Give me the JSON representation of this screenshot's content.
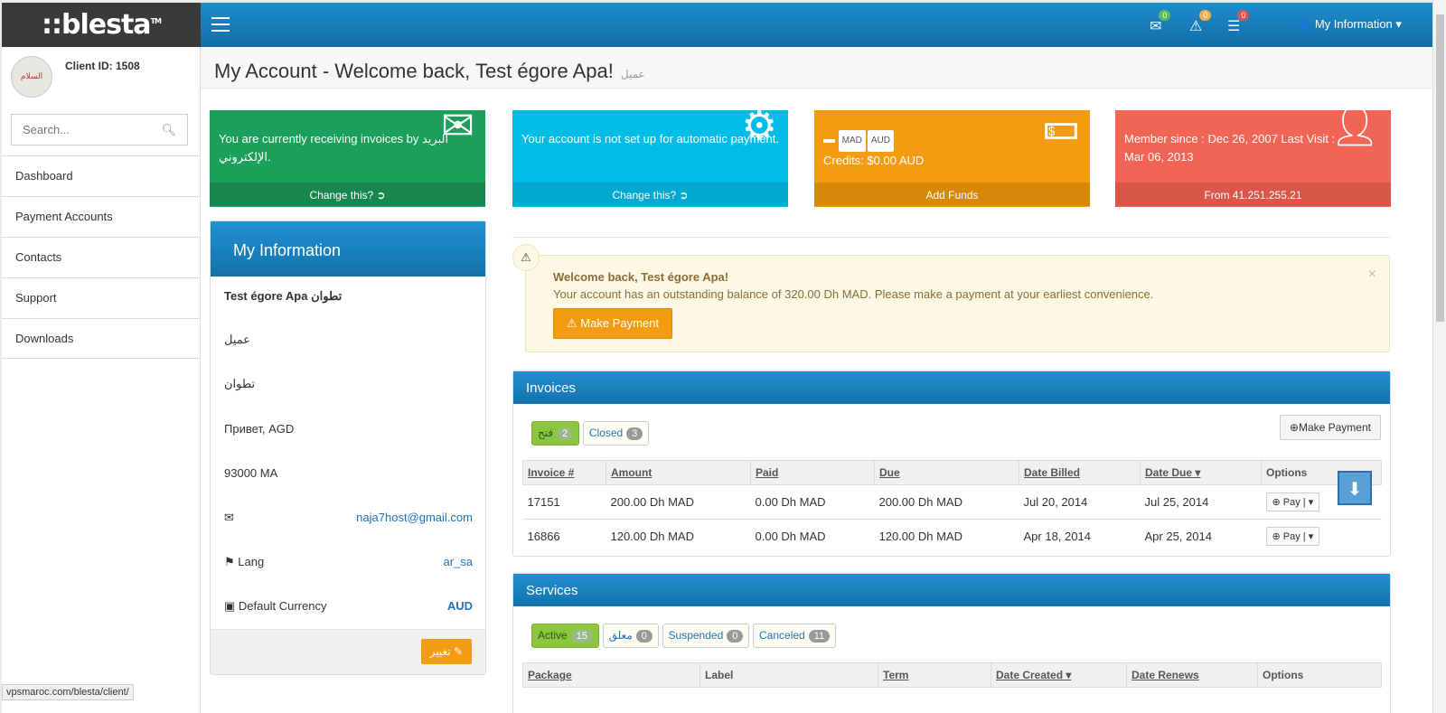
{
  "brand": {
    "logo_text": "::blesta",
    "tm": "TM"
  },
  "topbar": {
    "messages_count": "0",
    "alerts_count": "0",
    "tasks_count": "0",
    "user_menu": "My Information"
  },
  "sidebar": {
    "client_id": "Client ID: 1508",
    "avatar_text": "السلام",
    "search_placeholder": "Search...",
    "items": [
      {
        "label": "Dashboard"
      },
      {
        "label": "Payment Accounts"
      },
      {
        "label": "Contacts"
      },
      {
        "label": "Support"
      },
      {
        "label": "Downloads"
      }
    ]
  },
  "page": {
    "title": "My Account - Welcome back, Test égore Apa!",
    "subtitle": "عميل"
  },
  "tiles": [
    {
      "text": "You are currently receiving invoices by البريد الإلكتروني.",
      "footer": "Change this?",
      "color": "#1aa05a",
      "icon": "envelope-icon"
    },
    {
      "text": "Your account is not set up for automatic payment.",
      "footer": "Change this?",
      "color": "#00bde8",
      "icon": "gear-icon"
    },
    {
      "currencies": [
        "MAD",
        "AUD"
      ],
      "text": "Credits: $0.00 AUD",
      "footer": "Add Funds",
      "color": "#f39c12",
      "icon": "money-icon"
    },
    {
      "text": "Member since : Dec 26, 2007 Last Visit : Mar 06, 2013",
      "footer": "From 41.251.255.21",
      "color": "#f26455",
      "icon": "user-icon"
    }
  ],
  "info": {
    "title": "My Information",
    "name": "Test égore Apa تطوان",
    "company": "عميل",
    "city": "تطوان",
    "address": "Привет, AGD",
    "zip": "93000 MA",
    "email": "naja7host@gmail.com",
    "lang_label": "Lang",
    "lang_value": "ar_sa",
    "currency_label": "Default Currency",
    "currency_value": "AUD",
    "edit_label": "تغيير"
  },
  "alert": {
    "title": "Welcome back, Test égore Apa!",
    "message": "Your account has an outstanding balance of 320.00 Dh MAD. Please make a payment at your earliest convenience.",
    "button": "Make Payment"
  },
  "invoices": {
    "title": "Invoices",
    "tabs": [
      {
        "label": "فتح",
        "count": "2"
      },
      {
        "label": "Closed",
        "count": "3"
      }
    ],
    "make_payment": "Make Payment",
    "columns": [
      "Invoice #",
      "Amount",
      "Paid",
      "Due",
      "Date Billed",
      "Date Due",
      "Options"
    ],
    "rows": [
      {
        "invoice": "17151",
        "amount": "200.00 Dh MAD",
        "paid": "0.00 Dh MAD",
        "due": "200.00 Dh MAD",
        "billed": "Jul 20, 2014",
        "date_due": "Jul 25, 2014",
        "action": "Pay"
      },
      {
        "invoice": "16866",
        "amount": "120.00 Dh MAD",
        "paid": "0.00 Dh MAD",
        "due": "120.00 Dh MAD",
        "billed": "Apr 18, 2014",
        "date_due": "Apr 25, 2014",
        "action": "Pay"
      }
    ]
  },
  "services": {
    "title": "Services",
    "tabs": [
      {
        "label": "Active",
        "count": "15"
      },
      {
        "label": "معلق",
        "count": "0"
      },
      {
        "label": "Suspended",
        "count": "0"
      },
      {
        "label": "Canceled",
        "count": "11"
      }
    ],
    "columns": [
      "Package",
      "Label",
      "Term",
      "Date Created",
      "Date Renews",
      "Options"
    ]
  },
  "status_url": "vpsmaroc.com/blesta/client/"
}
